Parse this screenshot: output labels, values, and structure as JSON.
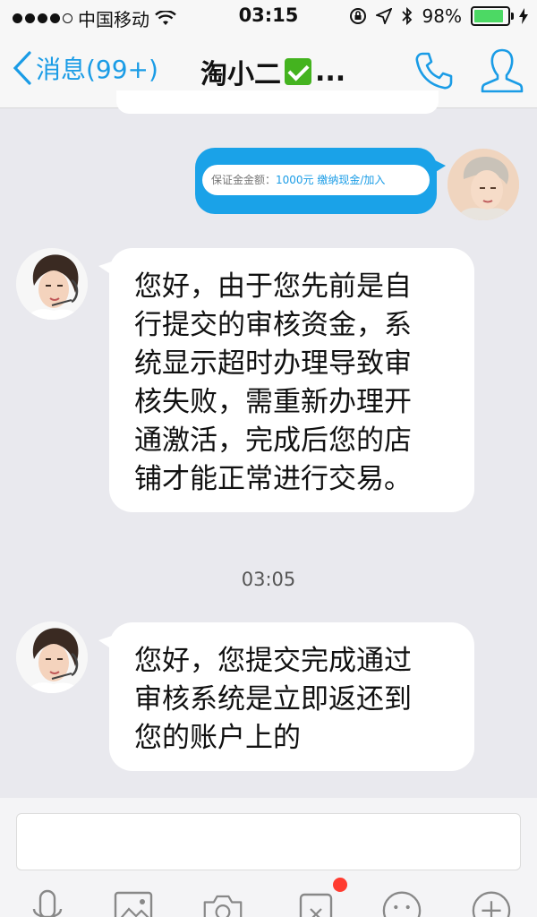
{
  "status_bar": {
    "carrier": "中国移动",
    "time": "03:15",
    "battery_percent": "98%",
    "battery_level": 0.98
  },
  "nav": {
    "back_label": "消息(99+)",
    "title": "淘小二",
    "title_suffix": "...",
    "accent_color": "#1a9ce6"
  },
  "messages": {
    "outgoing_card": {
      "text_prefix": "保证金金额：",
      "text_highlight": "1000元 缴纳现金/加入"
    },
    "incoming_1": {
      "lines": [
        "您好，由于您先前是自",
        "行提交的审核资金，系",
        "统显示超时办理导致审",
        "核失败，需重新办理开",
        "通激活，完成后您的店",
        "铺才能正常进行交易。"
      ]
    },
    "timestamp": "03:05",
    "incoming_2": {
      "lines": [
        "您好，您提交完成通过",
        "审核系统是立即返还到",
        "您的账户上的"
      ]
    }
  },
  "input": {
    "value": ""
  },
  "toolbar": {
    "icons": [
      "microphone-icon",
      "image-icon",
      "camera-icon",
      "shop-card-icon",
      "emoji-icon",
      "plus-icon"
    ]
  }
}
